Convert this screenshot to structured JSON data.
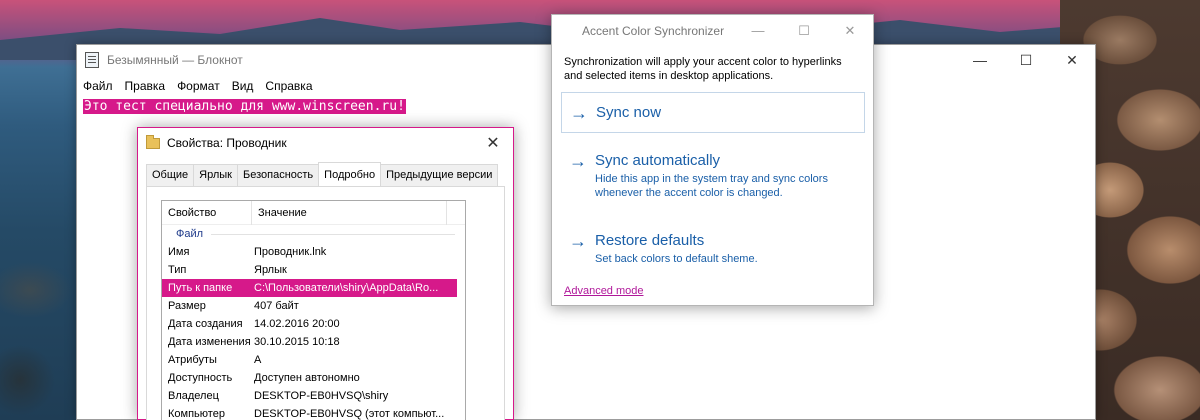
{
  "notepad": {
    "title": "Безымянный — Блокнот",
    "menu": [
      "Файл",
      "Правка",
      "Формат",
      "Вид",
      "Справка"
    ],
    "text": "Это тест специально для www.winscreen.ru!",
    "controls": {
      "minimize": "—",
      "maximize": "☐",
      "close": "✕"
    }
  },
  "properties": {
    "title": "Свойства: Проводник",
    "close": "✕",
    "tabs": [
      "Общие",
      "Ярлык",
      "Безопасность",
      "Подробно",
      "Предыдущие версии"
    ],
    "active_tab": "Подробно",
    "columns": [
      "Свойство",
      "Значение"
    ],
    "group": "Файл",
    "rows": [
      {
        "name": "Имя",
        "value": "Проводник.lnk"
      },
      {
        "name": "Тип",
        "value": "Ярлык"
      },
      {
        "name": "Путь к папке",
        "value": "C:\\Пользователи\\shiry\\AppData\\Ro..."
      },
      {
        "name": "Размер",
        "value": "407 байт"
      },
      {
        "name": "Дата создания",
        "value": "14.02.2016 20:00"
      },
      {
        "name": "Дата изменения",
        "value": "30.10.2015 10:18"
      },
      {
        "name": "Атрибуты",
        "value": "A"
      },
      {
        "name": "Доступность",
        "value": "Доступен автономно"
      },
      {
        "name": "Владелец",
        "value": "DESKTOP-EB0HVSQ\\shiry"
      },
      {
        "name": "Компьютер",
        "value": "DESKTOP-EB0HVSQ (этот компьют..."
      }
    ],
    "selected_row": 2
  },
  "synchronizer": {
    "title": "Accent Color Synchronizer",
    "controls": {
      "minimize": "—",
      "maximize": "☐",
      "close": "✕"
    },
    "description": "Synchronization will apply your accent color to hyperlinks and selected items in desktop applications.",
    "options": [
      {
        "label": "Sync now",
        "description": ""
      },
      {
        "label": "Sync automatically",
        "description": "Hide this app in the system tray and sync colors whenever the accent color is changed."
      },
      {
        "label": "Restore defaults",
        "description": "Set back colors to default sheme."
      }
    ],
    "advanced_link": "Advanced mode"
  },
  "colors": {
    "accent": "#d6198a",
    "link_blue": "#1a5fa8",
    "link_magenta": "#b0179a"
  }
}
